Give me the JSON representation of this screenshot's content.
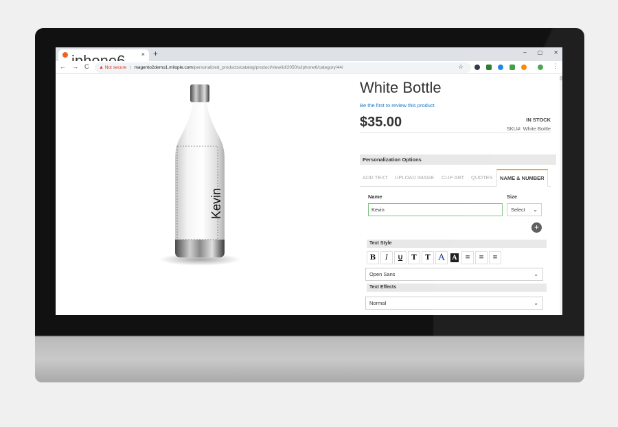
{
  "browser": {
    "tab_title": "iphone6",
    "tab_close": "×",
    "new_tab": "+",
    "window_controls": [
      "–",
      "▢",
      "✕"
    ],
    "nav": [
      "←",
      "→",
      "C"
    ],
    "not_secure": "Not secure",
    "separator": "|",
    "url_host": "magento2demo1.milople.com",
    "url_path": "/personalized_products/catalog/product/view/id/2050/s/iphone6/category/44/",
    "star": "☆",
    "menu": "⋮",
    "extension_colors": [
      "#333b4a",
      "#2e7d32",
      "#1e88e5",
      "#43a047",
      "#fb8c00",
      "#43a047"
    ]
  },
  "product": {
    "title": "White Bottle",
    "review_link": "Be the first to review this product",
    "price": "$35.00",
    "stock": "IN STOCK",
    "sku_label": "SKU#:",
    "sku_value": "White Bottle",
    "preview_text": "Kevin"
  },
  "personalization": {
    "header": "Personalization Options",
    "tabs": [
      "ADD TEXT",
      "UPLOAD IMAGE",
      "CLIP ART",
      "QUOTES",
      "NAME & NUMBER"
    ],
    "active_tab": "NAME & NUMBER",
    "name_label": "Name",
    "name_value": "Kevin",
    "size_label": "Size",
    "size_value": "Select",
    "add_button": "+",
    "text_style_label": "Text Style",
    "style_buttons": [
      "B",
      "I",
      "U",
      "T",
      "T",
      "A",
      "A",
      "≡",
      "≡",
      "≡"
    ],
    "font_value": "Open Sans",
    "text_effects_label": "Text Effects",
    "effect_value": "Normal",
    "chevron": "⌄"
  },
  "colors": {
    "link": "#1979c3",
    "accent_tab": "#f0a500",
    "input_focus": "#7dc27b",
    "warning": "#d93025"
  }
}
